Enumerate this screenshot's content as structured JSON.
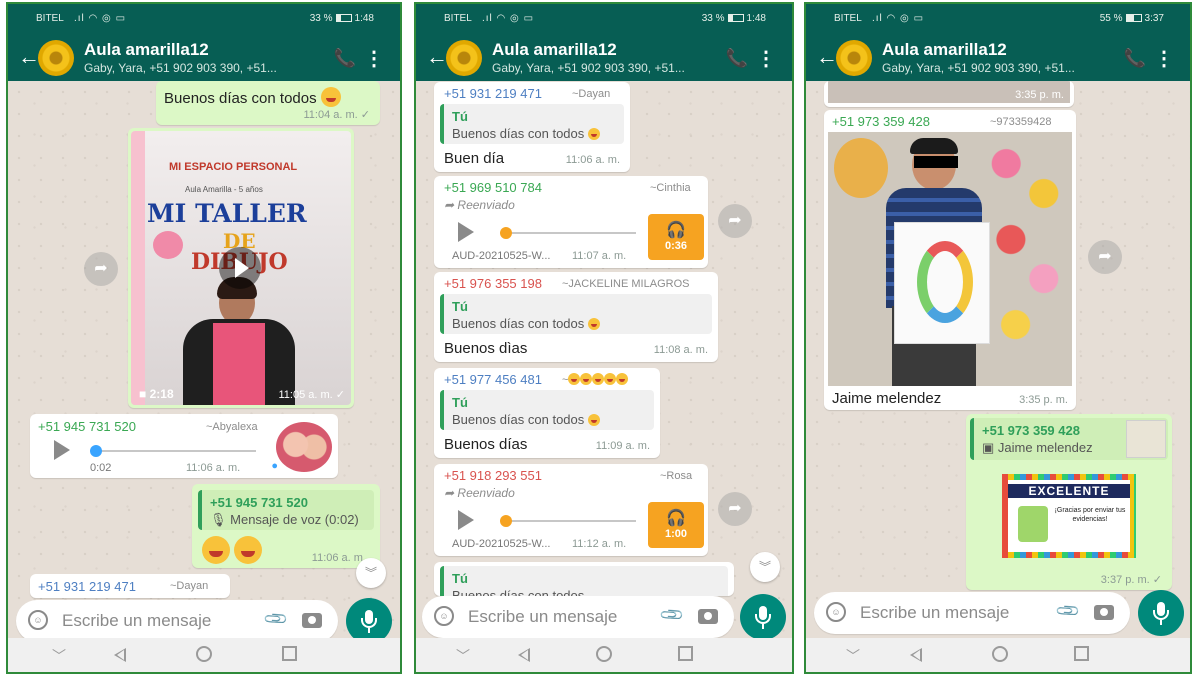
{
  "colors": {
    "header": "#075e54",
    "outgoing": "#dcf8c6",
    "accent": "#f6a321",
    "mic": "#00897b",
    "frame": "#2f8a3a"
  },
  "common": {
    "group_title": "Aula amarilla12",
    "group_subtitle": "Gaby, Yara, +51 902 903 390, +51...",
    "input_placeholder": "Escribe un mensaje",
    "icons": [
      "back-arrow-icon",
      "add-call-icon",
      "more-vert-icon",
      "emoji-icon",
      "attach-icon",
      "camera-icon",
      "mic-icon"
    ]
  },
  "phone1": {
    "status": {
      "carrier": "BITEL",
      "battery": "33 %",
      "time": "1:48"
    },
    "msg1": {
      "text": "Buenos días con todos",
      "time": "11:04 a. m."
    },
    "video": {
      "sign1": "MI ESPACIO PERSONAL",
      "sign2": "Aula Amarilla - 5 años",
      "sign3": "MI TALLER",
      "sign4": "DE",
      "sign5": "DIBUJO",
      "duration": "2:18",
      "time": "11:05 a. m."
    },
    "audio1": {
      "sender": "+51 945 731 520",
      "alias": "~Abyalexa",
      "duration": "0:02",
      "time": "11:06 a. m."
    },
    "reply1": {
      "quote_name": "+51 945 731 520",
      "quote_text": "Mensaje de voz (0:02)",
      "time": "11:06 a. m."
    },
    "peek": {
      "sender": "+51 931 219 471",
      "alias": "~Dayan"
    }
  },
  "phone2": {
    "status": {
      "carrier": "BITEL",
      "battery": "33 %",
      "time": "1:48"
    },
    "m1": {
      "sender": "+51 931 219 471",
      "alias": "~Dayan",
      "quote_name": "Tú",
      "quote_text": "Buenos días con todos",
      "text": "Buen día",
      "time": "11:06 a. m."
    },
    "m2": {
      "sender": "+51 969 510 784",
      "alias": "~Cinthia",
      "forwarded": "Reenviado",
      "file": "AUD-20210525-W...",
      "time": "11:07 a. m.",
      "duration": "0:36"
    },
    "m3": {
      "sender": "+51 976 355 198",
      "alias": "~JACKELINE MILAGROS",
      "quote_name": "Tú",
      "quote_text": "Buenos días con todos",
      "text": "Buenos dìas",
      "time": "11:08 a. m."
    },
    "m4": {
      "sender": "+51 977 456 481",
      "alias": "~",
      "quote_name": "Tú",
      "quote_text": "Buenos días con todos",
      "text": "Buenos días",
      "time": "11:09 a. m."
    },
    "m5": {
      "sender": "+51 918 293 551",
      "alias": "~Rosa",
      "forwarded": "Reenviado",
      "file": "AUD-20210525-W...",
      "time": "11:12 a. m.",
      "duration": "1:00"
    },
    "m6": {
      "quote_name": "Tú",
      "quote_text": "Buenos días con todos"
    }
  },
  "phone3": {
    "status": {
      "carrier": "BITEL",
      "battery": "55 %",
      "time": "3:37"
    },
    "prev": {
      "time": "3:35 p. m."
    },
    "photo": {
      "sender": "+51 973 359 428",
      "alias": "~973359428",
      "caption": "Jaime melendez",
      "time": "3:35 p. m."
    },
    "reply": {
      "quote_name": "+51 973 359 428",
      "quote_text": "Jaime melendez",
      "sticker_title": "EXCELENTE",
      "sticker_text": "¡Gracias por enviar tus evidencias!",
      "time": "3:37 p. m."
    }
  }
}
